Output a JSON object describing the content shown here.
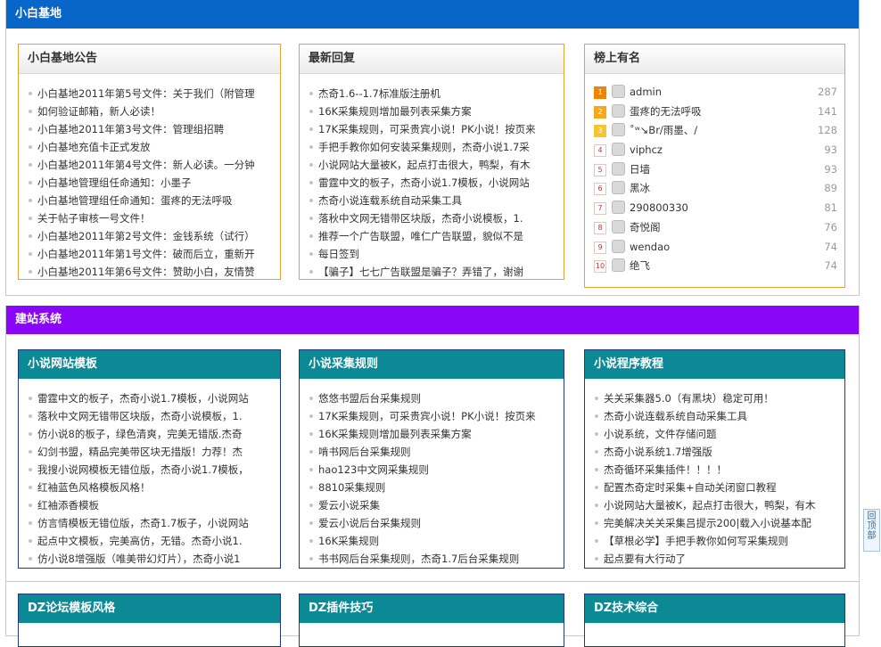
{
  "section1": {
    "title": "小白基地",
    "boxes": [
      {
        "title": "小白基地公告",
        "items": [
          "小白基地2011年第5号文件：关于我们（附管理",
          "如何验证邮箱，新人必读！",
          "小白基地2011年第3号文件：管理组招聘",
          "小白基地充值卡正式发放",
          "小白基地2011年第4号文件：新人必读。一分钟",
          "小白基地管理组任命通知：小墨子",
          "小白基地管理组任命通知：蛋疼的无法呼吸",
          "关于帖子审核一号文件！",
          "小白基地2011年第2号文件：金钱系统（试行）",
          "小白基地2011年第1号文件：破而后立，重新开",
          "小白基地2011年第6号文件：赞助小白，友情赞"
        ]
      },
      {
        "title": "最新回复",
        "items": [
          "杰奇1.6--1.7标准版注册机",
          "16K采集规则增加最列表采集方案",
          "17K采集规则，可采贵宾小说！PK小说！按页来",
          "手把手教你如何安装采集规则，杰奇小说1.7采",
          "小说网站大量被K，起点打击很大，鸭梨，有木",
          "雷霆中文的板子，杰奇小说1.7模板，小说网站",
          "杰奇小说连载系统自动采集工具",
          "落秋中文网无错带区块版，杰奇小说模板，1.",
          "推荐一个广告联盟，唯仁广告联盟，貌似不是",
          "每日签到",
          "【骗子】七七广告联盟是骗子？弄错了，谢谢"
        ]
      }
    ],
    "rank": {
      "title": "榜上有名",
      "items": [
        {
          "num": "1",
          "name": "admin",
          "count": "287"
        },
        {
          "num": "2",
          "name": "蛋疼的无法呼吸",
          "count": "141"
        },
        {
          "num": "3",
          "name": "˚ʷ↘Br/雨墨、/",
          "count": "128"
        },
        {
          "num": "4",
          "name": "viphcz",
          "count": "93"
        },
        {
          "num": "5",
          "name": "日墙",
          "count": "93"
        },
        {
          "num": "6",
          "name": "黑冰",
          "count": "89"
        },
        {
          "num": "7",
          "name": "290800330",
          "count": "81"
        },
        {
          "num": "8",
          "name": "奇悦阁",
          "count": "76"
        },
        {
          "num": "9",
          "name": "wendao",
          "count": "74"
        },
        {
          "num": "10",
          "name": "绝飞",
          "count": "74"
        }
      ]
    }
  },
  "section2": {
    "title": "建站系统",
    "boxes": [
      {
        "title": "小说网站模板",
        "items": [
          "雷霆中文的板子，杰奇小说1.7模板，小说网站",
          "落秋中文网无错带区块版，杰奇小说模板，1.",
          "仿小说8的板子，绿色清爽，完美无错版.杰奇",
          "幻剑书盟，精品完美带区块无措版！力荐！杰",
          "我搜小说网模板无错位版，杰奇小说1.7模板，",
          "红袖蓝色风格模板风格！",
          "红袖添香模板",
          "仿言情模板无错位版，杰奇1.7板子，小说网站",
          "起点中文模板，完美高仿，无错。杰奇小说1.",
          "仿小说8增强版（唯美带幻灯片），杰奇小说1"
        ]
      },
      {
        "title": "小说采集规则",
        "items": [
          "悠悠书盟后台采集规则",
          "17K采集规则，可采贵宾小说！PK小说！按页来",
          "16K采集规则增加最列表采集方案",
          "啃书网后台采集规则",
          "hao123中文网采集规则",
          "8810采集规则",
          "爱云小说采集",
          "爱云小说后台采集规则",
          "16K采集规则",
          "书书网后台采集规则，杰奇1.7后台采集规则"
        ]
      },
      {
        "title": "小说程序教程",
        "items": [
          "关关采集器5.0（有黑块）稳定可用！",
          "杰奇小说连载系统自动采集工具",
          "小说系统，文件存储问题",
          "杰奇小说系统1.7增强版",
          "杰奇循环采集插件！！！！",
          "配置杰奇定时采集+自动关闭窗口教程",
          "小说网站大量被K，起点打击很大，鸭梨，有木",
          "完美解决关关采集吕提示200|载入小说基本配",
          "【草根必学】手把手教你如何写采集规则",
          "起点要有大行动了"
        ]
      }
    ]
  },
  "section3": {
    "boxes": [
      {
        "title": "DZ论坛模板风格"
      },
      {
        "title": "DZ插件技巧"
      },
      {
        "title": "DZ技术综合"
      }
    ]
  },
  "back_to_top": "回顶部",
  "colors": {
    "blue_bar": "#0866c9",
    "purple_bar": "#8a06f6",
    "teal_head": "#0b8a96",
    "gold_border": "#e1a530"
  }
}
